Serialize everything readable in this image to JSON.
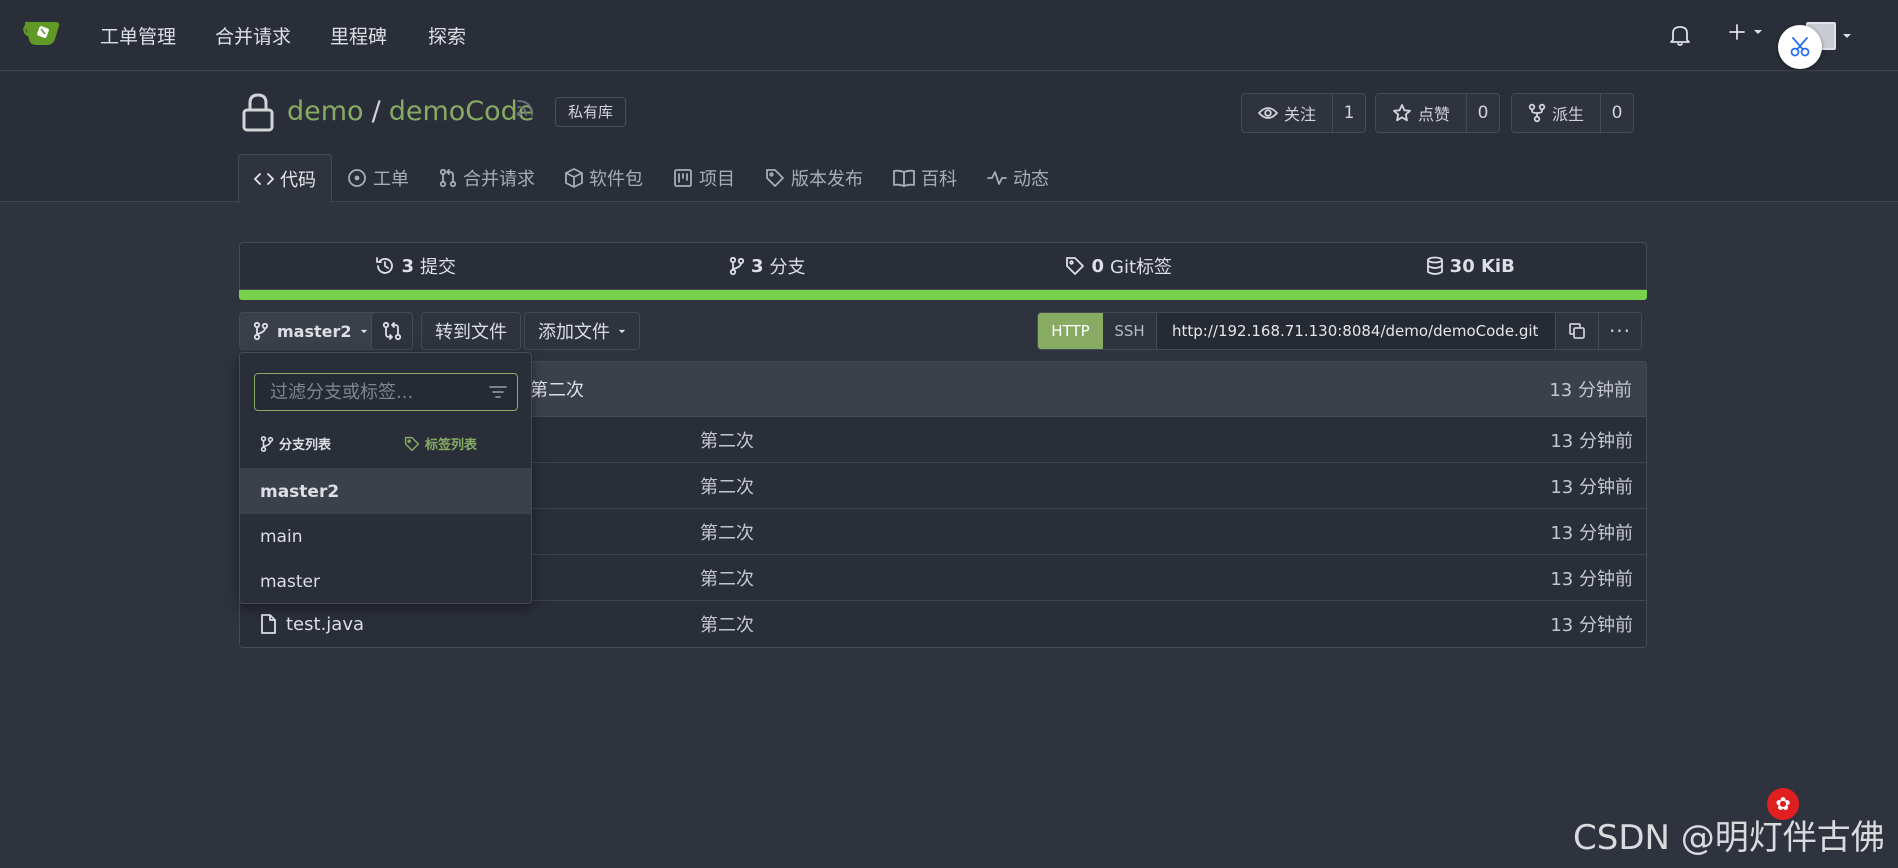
{
  "topnav": {
    "items": [
      "工单管理",
      "合并请求",
      "里程碑",
      "探索"
    ]
  },
  "repo": {
    "owner": "demo",
    "separator": "/",
    "name": "demoCode",
    "visibility": "私有库",
    "watch": {
      "label": "关注",
      "count": "1"
    },
    "star": {
      "label": "点赞",
      "count": "0"
    },
    "fork": {
      "label": "派生",
      "count": "0"
    }
  },
  "tabs": [
    {
      "label": "代码",
      "icon": "code-icon"
    },
    {
      "label": "工单",
      "icon": "issue-icon"
    },
    {
      "label": "合并请求",
      "icon": "pull-request-icon"
    },
    {
      "label": "软件包",
      "icon": "package-icon"
    },
    {
      "label": "项目",
      "icon": "project-icon"
    },
    {
      "label": "版本发布",
      "icon": "tag-icon"
    },
    {
      "label": "百科",
      "icon": "book-icon"
    },
    {
      "label": "动态",
      "icon": "pulse-icon"
    }
  ],
  "stats": {
    "commits_count": "3",
    "commits_label": "提交",
    "branches_count": "3",
    "branches_label": "分支",
    "tags_count": "0",
    "tags_label": "Git标签",
    "size": "30 KiB"
  },
  "toolbar": {
    "branch": "master2",
    "goto_file": "转到文件",
    "add_file": "添加文件",
    "http": "HTTP",
    "ssh": "SSH",
    "clone_url": "http://192.168.71.130:8084/demo/demoCode.git",
    "more": "···"
  },
  "latest_commit": {
    "message": "第二次",
    "time": "13 分钟前"
  },
  "files": [
    {
      "name": "",
      "message": "第二次",
      "time": "13 分钟前"
    },
    {
      "name": "",
      "message": "第二次",
      "time": "13 分钟前"
    },
    {
      "name": "",
      "message": "第二次",
      "time": "13 分钟前"
    },
    {
      "name": "",
      "message": "第二次",
      "time": "13 分钟前"
    },
    {
      "name": "test.java",
      "message": "第二次",
      "time": "13 分钟前"
    }
  ],
  "branch_menu": {
    "filter_placeholder": "过滤分支或标签...",
    "tab_branches": "分支列表",
    "tab_tags": "标签列表",
    "items": [
      "master2",
      "main",
      "master"
    ]
  },
  "watermark": "CSDN @明灯伴古佛",
  "colors": {
    "accent": "#87ab63",
    "language_bar": "#79d14b",
    "background": "#2f333d"
  }
}
